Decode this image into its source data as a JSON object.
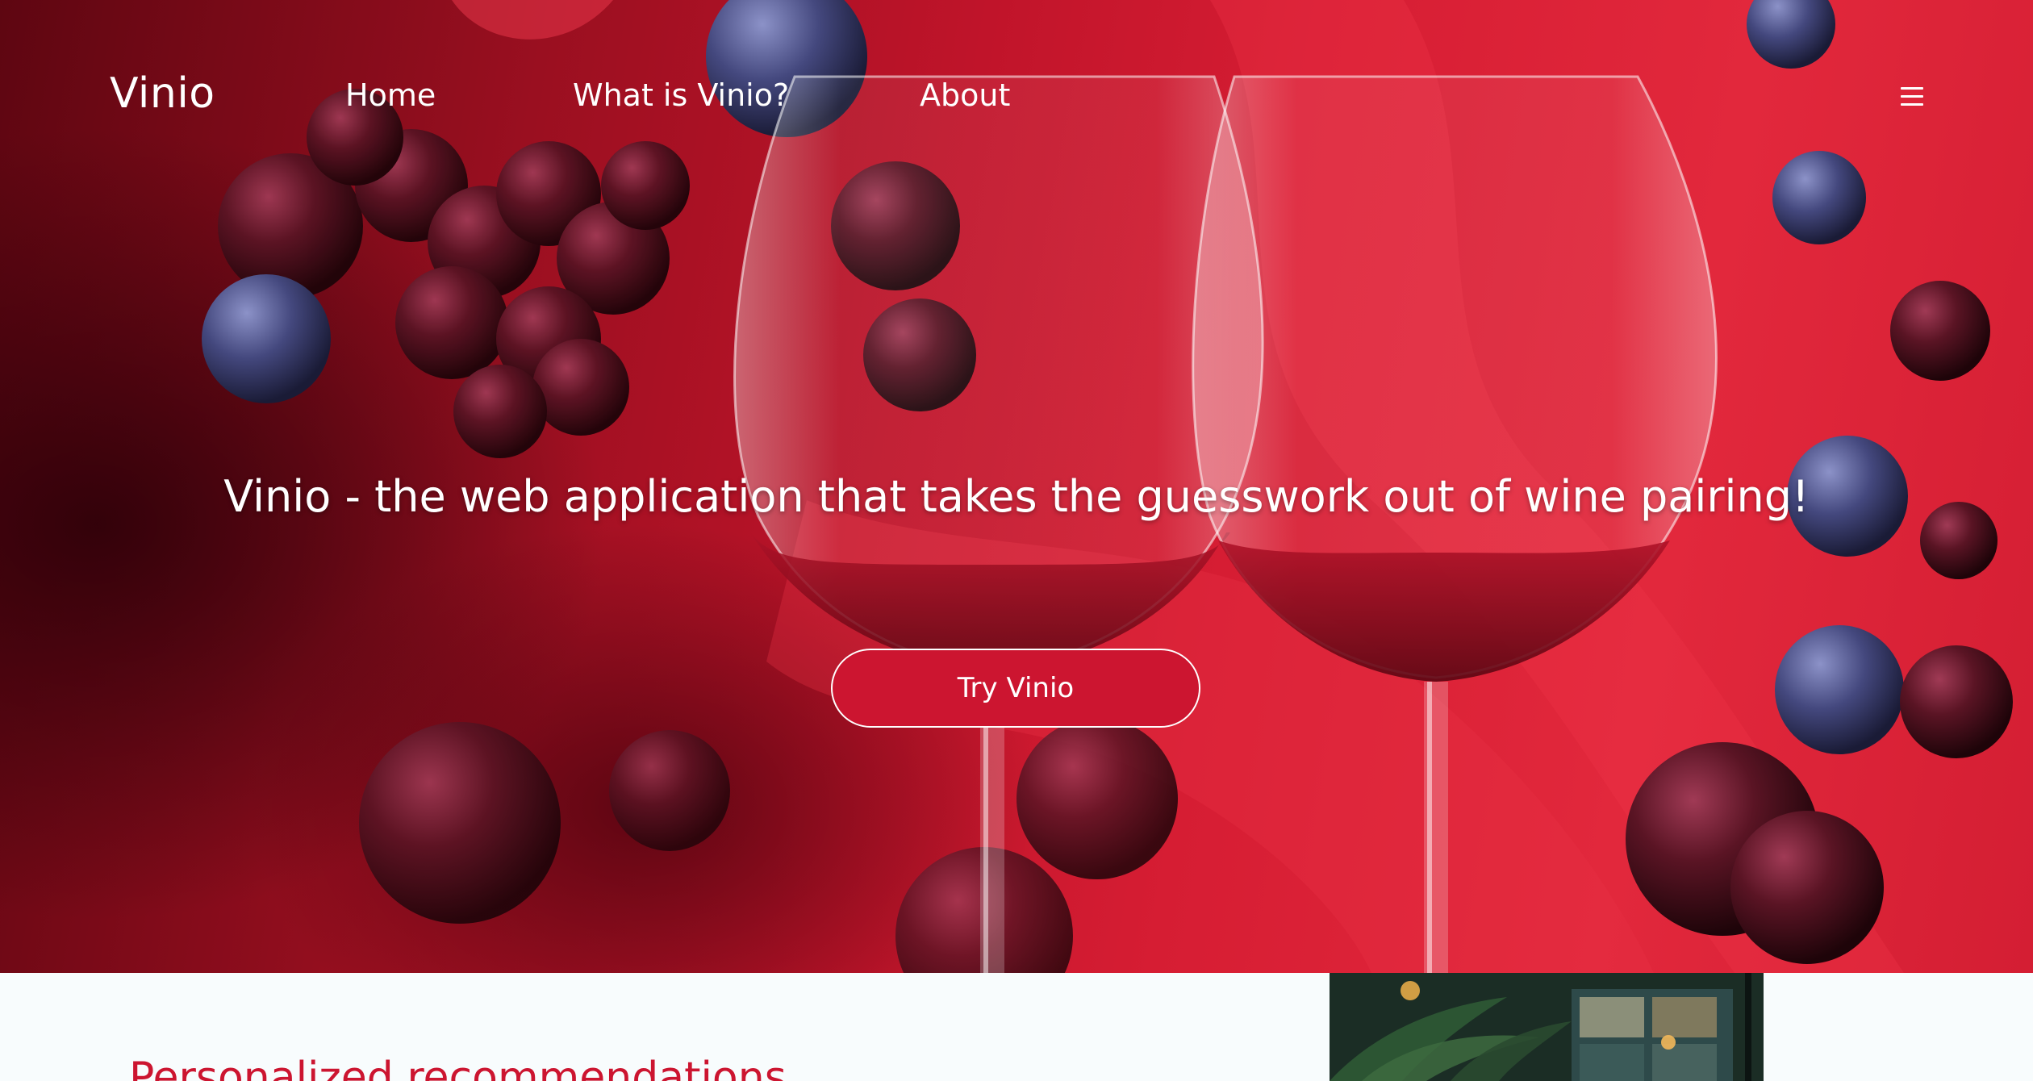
{
  "nav": {
    "brand": "Vinio",
    "links": [
      {
        "label": "Home"
      },
      {
        "label": "What is Vinio?"
      },
      {
        "label": "About"
      }
    ],
    "menu_icon": "hamburger-menu-icon"
  },
  "hero": {
    "headline": "Vinio - the web application that takes the guesswork out of wine pairing!",
    "cta_label": "Try Vinio",
    "image": "wine-glasses-with-grapes-and-blueberries"
  },
  "features": {
    "title": "Personalized recommendations",
    "image": "restaurant-interior-with-palm"
  },
  "colors": {
    "accent": "#cc1530",
    "hero_red": "#d61d33",
    "text_light": "#ffffff",
    "page_bg": "#f8fcfd"
  }
}
